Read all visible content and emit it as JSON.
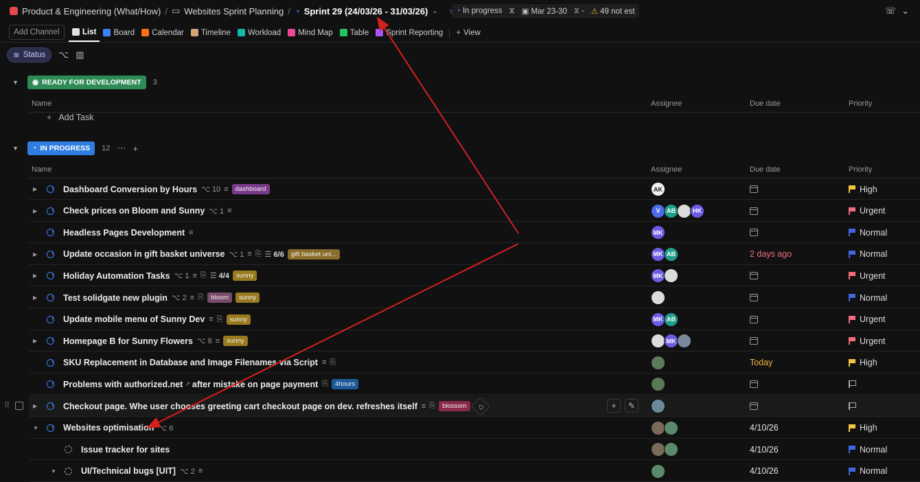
{
  "breadcrumb": {
    "workspace": "Product & Engineering (What/How)",
    "folder": "Websites Sprint Planning",
    "current": "Sprint 29 (24/03/26 - 31/03/26)"
  },
  "sprint_meta": {
    "status": "In progress",
    "dates": "Mar 23-30",
    "points": "-",
    "estimate": "49 not est"
  },
  "toolbar": {
    "add_channel": "Add Channel",
    "views": [
      {
        "label": "List",
        "icon": "list-icon",
        "color": "#e0e0e0"
      },
      {
        "label": "Board",
        "icon": "board-icon",
        "color": "#3b82f6"
      },
      {
        "label": "Calendar",
        "icon": "calendar-icon",
        "color": "#f97316"
      },
      {
        "label": "Timeline",
        "icon": "timeline-icon",
        "color": "#d4a373"
      },
      {
        "label": "Workload",
        "icon": "workload-icon",
        "color": "#14b8a6"
      },
      {
        "label": "Mind Map",
        "icon": "mindmap-icon",
        "color": "#ec4899"
      },
      {
        "label": "Table",
        "icon": "table-icon",
        "color": "#22c55e"
      },
      {
        "label": "Sprint Reporting",
        "icon": "sprint-reporting-icon",
        "color": "#a855f7"
      }
    ],
    "add_view": "View"
  },
  "filters": {
    "status": "Status"
  },
  "columns": {
    "name": "Name",
    "assignee": "Assignee",
    "due": "Due date",
    "priority": "Priority"
  },
  "groups": {
    "ready": {
      "label": "READY FOR DEVELOPMENT",
      "count": "3",
      "color": "#2e8b57",
      "add_task": "Add Task"
    },
    "progress": {
      "label": "IN PROGRESS",
      "count": "12",
      "color": "#2f7de1"
    }
  },
  "tasks": [
    {
      "name": "Dashboard Conversion by Hours",
      "subtasks": "10",
      "desc": true,
      "tags": [
        {
          "t": "dashboard",
          "c": "#7b3b8c"
        }
      ],
      "assignees": [
        {
          "i": "AK",
          "c": "#f0f0f0",
          "fc": "#222"
        }
      ],
      "due": "",
      "priority": "High",
      "pc": "#f5c542",
      "expand": true
    },
    {
      "name": "Check prices on Bloom and Sunny",
      "subtasks": "1",
      "desc": true,
      "tags": [],
      "assignees": [
        {
          "i": "V",
          "c": "#4f6bed"
        },
        {
          "i": "AB",
          "c": "#1f9d8a"
        },
        {
          "i": "",
          "c": "#dcdcdc"
        },
        {
          "i": "HK",
          "c": "#6a5be2"
        }
      ],
      "due": "",
      "priority": "Urgent",
      "pc": "#f26d7d",
      "expand": true
    },
    {
      "name": "Headless Pages Development",
      "subtasks": "",
      "desc": true,
      "tags": [],
      "assignees": [
        {
          "i": "MK",
          "c": "#6a5be2"
        }
      ],
      "due": "",
      "priority": "Normal",
      "pc": "#4066e0",
      "expand": false
    },
    {
      "name": "Update occasion in gift basket universe",
      "subtasks": "1",
      "desc": true,
      "attach": true,
      "checklist": "6/6",
      "tags": [
        {
          "t": "gift basket uni...",
          "c": "#8a6d2a"
        }
      ],
      "assignees": [
        {
          "i": "MK",
          "c": "#6a5be2"
        },
        {
          "i": "AB",
          "c": "#1f9d8a"
        }
      ],
      "due": "2 days ago",
      "dc": "#f26d7d",
      "priority": "Normal",
      "pc": "#4066e0",
      "expand": true
    },
    {
      "name": "Holiday Automation Tasks",
      "subtasks": "1",
      "desc": true,
      "attach": true,
      "checklist": "4/4",
      "tags": [
        {
          "t": "sunny",
          "c": "#9a7a1f"
        }
      ],
      "assignees": [
        {
          "i": "MK",
          "c": "#6a5be2"
        },
        {
          "i": "",
          "c": "#dcdcdc"
        }
      ],
      "due": "",
      "priority": "Urgent",
      "pc": "#f26d7d",
      "expand": true
    },
    {
      "name": "Test solidgate new plugin",
      "subtasks": "2",
      "desc": true,
      "attach": true,
      "tags": [
        {
          "t": "bloom",
          "c": "#7a4a6a"
        },
        {
          "t": "sunny",
          "c": "#9a7a1f"
        }
      ],
      "assignees": [
        {
          "i": "",
          "c": "#dcdcdc"
        }
      ],
      "due": "",
      "priority": "Normal",
      "pc": "#4066e0",
      "expand": true
    },
    {
      "name": "Update mobile menu of Sunny Dev",
      "subtasks": "",
      "desc": true,
      "attach": true,
      "tags": [
        {
          "t": "sunny",
          "c": "#9a7a1f"
        }
      ],
      "assignees": [
        {
          "i": "MK",
          "c": "#6a5be2"
        },
        {
          "i": "AB",
          "c": "#1f9d8a"
        }
      ],
      "due": "",
      "priority": "Urgent",
      "pc": "#f26d7d",
      "expand": false
    },
    {
      "name": "Homepage B for Sunny Flowers",
      "subtasks": "8",
      "desc": true,
      "tags": [
        {
          "t": "sunny",
          "c": "#9a7a1f"
        }
      ],
      "assignees": [
        {
          "i": "",
          "c": "#dcdcdc"
        },
        {
          "i": "MK",
          "c": "#6a5be2"
        },
        {
          "i": "",
          "c": "#7a8a9a"
        }
      ],
      "due": "",
      "priority": "Urgent",
      "pc": "#f26d7d",
      "expand": true
    },
    {
      "name": "SKU Replacement in Database and Image Filenames via Script",
      "subtasks": "",
      "desc": true,
      "attach": true,
      "tags": [],
      "assignees": [
        {
          "i": "",
          "c": "#5a7a5a"
        }
      ],
      "due": "Today",
      "dc": "#f5b342",
      "priority": "High",
      "pc": "#f5c542",
      "expand": false
    },
    {
      "name": "Problems with authorized.net",
      "extlink": true,
      "name2": "after mistake on page payment",
      "subtasks": "",
      "attach": true,
      "tags": [
        {
          "t": "4hours",
          "c": "#1e5a9a"
        }
      ],
      "assignees": [
        {
          "i": "",
          "c": "#5a7a5a"
        }
      ],
      "due": "",
      "priority": "",
      "pc": "",
      "expand": false
    },
    {
      "name": "Checkout page. Whe user chooses greeting cart checkout page on dev. refreshes itself",
      "subtasks": "",
      "desc": true,
      "attach": true,
      "tags": [
        {
          "t": "blossom",
          "c": "#8a2a4a"
        }
      ],
      "tagbtn": true,
      "assignees": [
        {
          "i": "",
          "c": "#6a8a9a"
        }
      ],
      "due": "",
      "priority": "",
      "pc": "",
      "expand": true,
      "hover": true
    },
    {
      "name": "Websites optimisation",
      "subtasks": "6",
      "tags": [],
      "assignees": [
        {
          "i": "",
          "c": "#7a6a5a"
        },
        {
          "i": "",
          "c": "#5a8a6a"
        }
      ],
      "due": "4/10/26",
      "dc": "#e6e6e6",
      "priority": "High",
      "pc": "#f5c542",
      "expand": "open"
    },
    {
      "name": "Issue tracker for sites",
      "sub": true,
      "subtasks": "",
      "tags": [],
      "assignees": [
        {
          "i": "",
          "c": "#7a6a5a"
        },
        {
          "i": "",
          "c": "#5a8a6a"
        }
      ],
      "due": "4/10/26",
      "dc": "#e6e6e6",
      "priority": "Normal",
      "pc": "#4066e0",
      "expand": false
    },
    {
      "name": "UI/Technical bugs [UIT]",
      "sub": true,
      "subtasks": "2",
      "desc": true,
      "tags": [],
      "assignees": [
        {
          "i": "",
          "c": "#5a8a6a"
        }
      ],
      "due": "4/10/26",
      "dc": "#e6e6e6",
      "priority": "Normal",
      "pc": "#4066e0",
      "expand": "open"
    }
  ]
}
